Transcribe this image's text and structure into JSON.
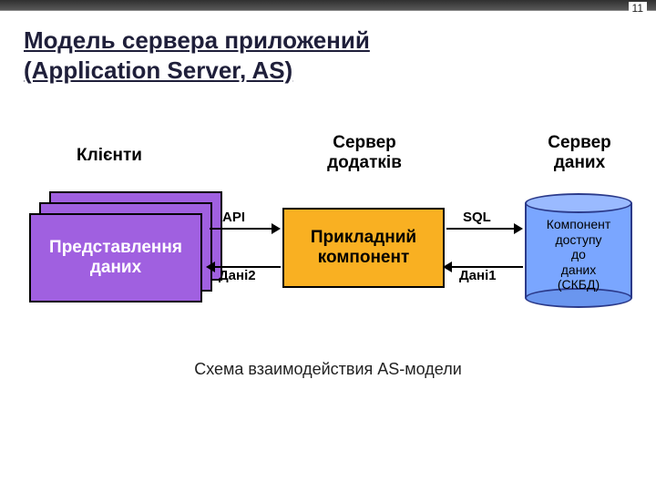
{
  "page_number": "11",
  "title": "Модель сервера приложений\n(Application Server, AS)",
  "columns": {
    "clients": "Клієнти",
    "app_server": "Сервер\nдодатків",
    "data_server": "Сервер\nданих"
  },
  "boxes": {
    "client": "Представлення\nданих",
    "app": "Прикладний\nкомпонент",
    "db": "Компонент\nдоступу\nдо\nданих\n(СКБД)"
  },
  "arrows": {
    "api": "API",
    "dani2": "Дані2",
    "sql": "SQL",
    "dani1": "Дані1"
  },
  "caption": "Схема взаимодействия AS-модели"
}
